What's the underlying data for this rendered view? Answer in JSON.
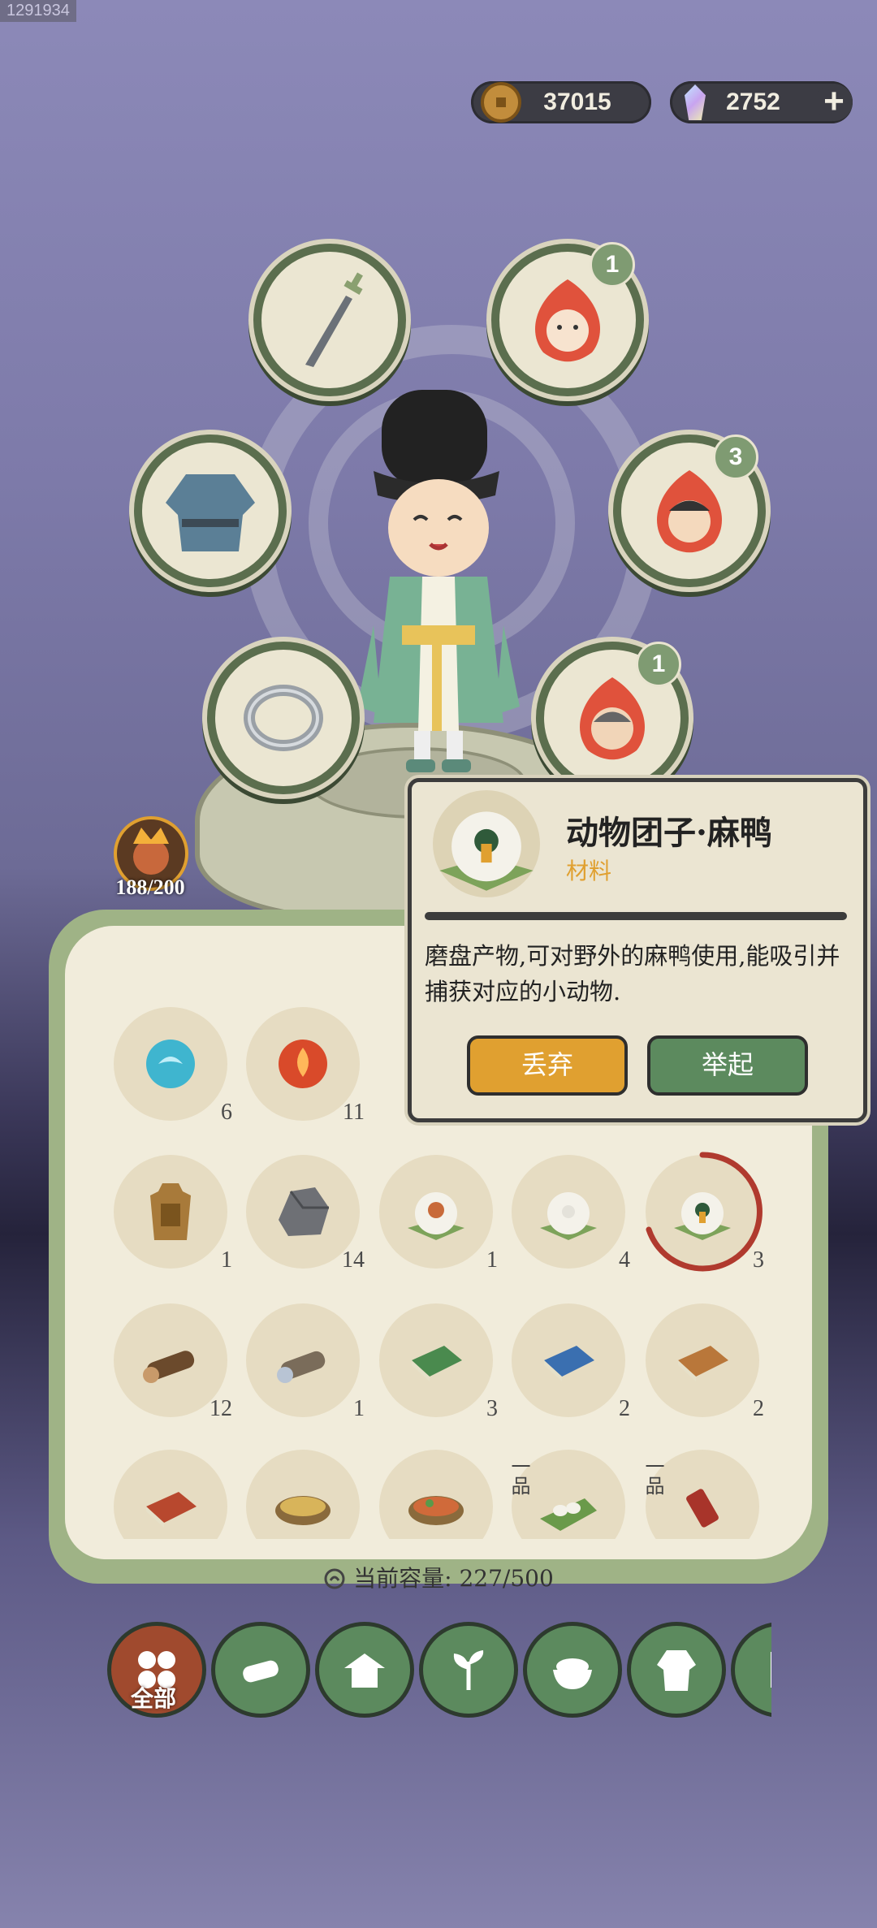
{
  "screenshot_id": "1291934",
  "currency": {
    "coins": "37015",
    "jade": "2752"
  },
  "equipment": {
    "slots": [
      {
        "name": "weapon",
        "badge": ""
      },
      {
        "name": "pet-1",
        "badge": "1"
      },
      {
        "name": "armor",
        "badge": ""
      },
      {
        "name": "pet-2",
        "badge": "3"
      },
      {
        "name": "ring",
        "badge": ""
      },
      {
        "name": "pet-3",
        "badge": "1"
      }
    ]
  },
  "stamina": {
    "value": "188/200"
  },
  "popup": {
    "title": "动物团子·麻鸭",
    "category": "材料",
    "description": "磨盘产物,可对野外的麻鸭使用,能吸引并捕获对应的小动物.",
    "discard_label": "丢弃",
    "lift_label": "举起"
  },
  "inventory": {
    "row1": [
      {
        "icon": "blue-orb-icon",
        "count": "6"
      },
      {
        "icon": "red-orb-icon",
        "count": "11"
      }
    ],
    "row2": [
      {
        "icon": "bronze-token-icon",
        "count": "1"
      },
      {
        "icon": "stone-icon",
        "count": "14"
      },
      {
        "icon": "chicken-dumpling-icon",
        "count": "1"
      },
      {
        "icon": "white-dumpling-icon",
        "count": "4"
      },
      {
        "icon": "duck-dumpling-icon",
        "count": "3"
      }
    ],
    "row3": [
      {
        "icon": "wood-log-icon",
        "count": "12"
      },
      {
        "icon": "birch-log-icon",
        "count": "1"
      },
      {
        "icon": "green-book-icon",
        "count": "3"
      },
      {
        "icon": "blue-book-icon",
        "count": "2"
      },
      {
        "icon": "orange-book-icon",
        "count": "2"
      }
    ],
    "row4": [
      {
        "icon": "red-book-icon",
        "grade": ""
      },
      {
        "icon": "grain-basket-icon",
        "grade": ""
      },
      {
        "icon": "vegetable-basket-icon",
        "grade": ""
      },
      {
        "icon": "eggs-leaf-icon",
        "grade": "一品"
      },
      {
        "icon": "thread-spool-icon",
        "grade": "一品"
      }
    ]
  },
  "capacity": {
    "label": "当前容量:",
    "value": "227/500"
  },
  "tabs": {
    "all_label": "全部"
  },
  "colors": {
    "accent_green": "#5c8a5e",
    "accent_orange": "#e0a030",
    "panel": "#f1ecdb"
  }
}
